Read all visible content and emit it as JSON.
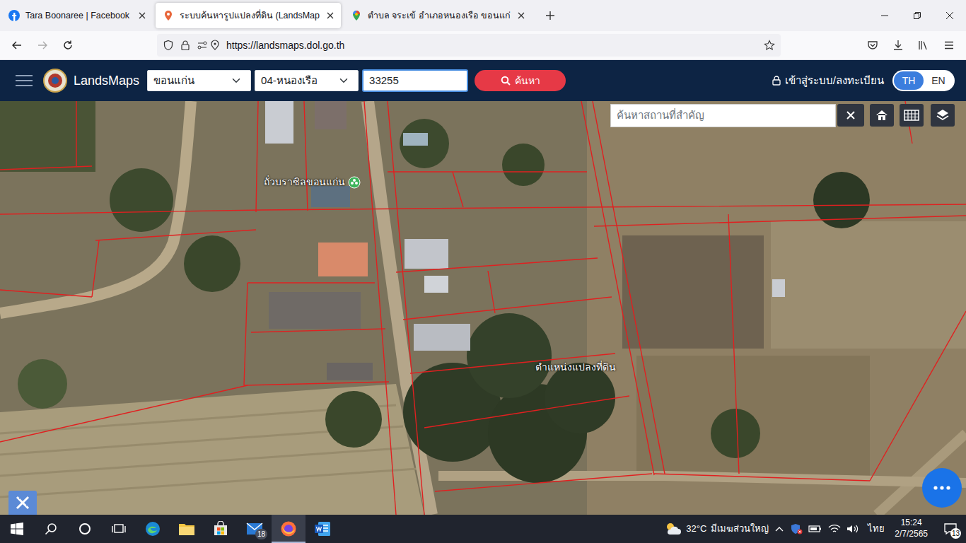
{
  "browser": {
    "tabs": [
      {
        "label": "Tara Boonaree | Facebook",
        "selected": false,
        "kind": "facebook"
      },
      {
        "label": "ระบบค้นหารูปแปลงที่ดิน (LandsMap",
        "selected": true,
        "kind": "landsmaps"
      },
      {
        "label": "ตำบล จระเข้ อำเภอหนองเรือ ขอนแก่",
        "selected": false,
        "kind": "maps"
      }
    ],
    "url": "https://landsmaps.dol.go.th"
  },
  "app": {
    "brand": "LandsMaps",
    "province": "ขอนแก่น",
    "district": "04-หนองเรือ",
    "parcel": "33255",
    "search_button": "ค้นหา",
    "login": "เข้าสู่ระบบ/ลงทะเบียน",
    "languages": [
      {
        "label": "TH",
        "selected": true
      },
      {
        "label": "EN",
        "selected": false
      }
    ]
  },
  "map": {
    "search": {
      "placeholder": "ค้นหาสถานที่สำคัญ"
    },
    "labels": [
      {
        "text": "ถั่วบราซิลขอนแก่น",
        "kind": "poi"
      },
      {
        "text": "ตำแหน่งแปลงที่ดิน",
        "kind": "parcel"
      }
    ]
  },
  "taskbar": {
    "apps": [
      {
        "kind": "edge",
        "selected": false,
        "badge": ""
      },
      {
        "kind": "explorer",
        "selected": false,
        "badge": ""
      },
      {
        "kind": "store",
        "selected": false,
        "badge": ""
      },
      {
        "kind": "mail",
        "selected": false,
        "badge": "18"
      },
      {
        "kind": "firefox",
        "selected": true,
        "badge": ""
      },
      {
        "kind": "word",
        "selected": false,
        "badge": ""
      }
    ],
    "weather": {
      "temp": "32°C",
      "text": "มีเมฆส่วนใหญ่"
    },
    "language": "ไทย",
    "time": "15:24",
    "date": "2/7/2565",
    "notifications": "13"
  }
}
